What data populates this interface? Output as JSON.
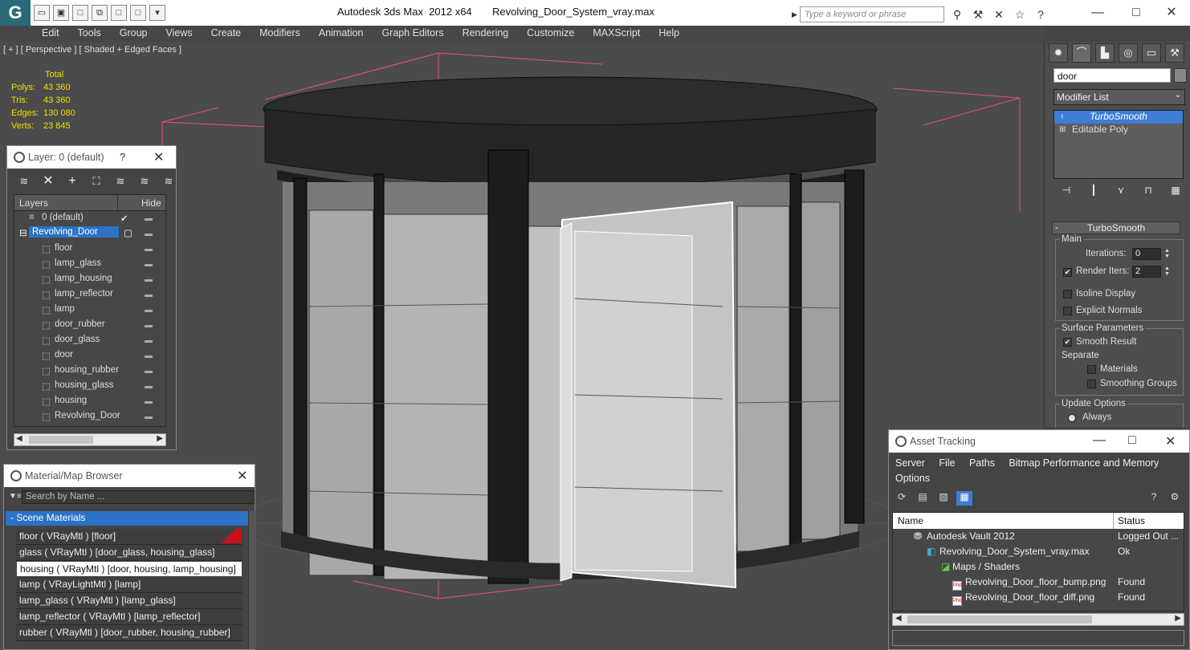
{
  "app": {
    "title": "Autodesk 3ds Max  2012 x64",
    "file": "Revolving_Door_System_vray.max",
    "logo": "max-logo",
    "search_placeholder": "Type a keyword or phrase"
  },
  "menu": [
    "Edit",
    "Tools",
    "Group",
    "Views",
    "Create",
    "Modifiers",
    "Animation",
    "Graph Editors",
    "Rendering",
    "Customize",
    "MAXScript",
    "Help"
  ],
  "viewport": {
    "label": "[ + ] [ Perspective ] [ Shaded + Edged Faces ]",
    "stats_header": "Total",
    "stats": [
      {
        "k": "Polys:",
        "v": "43 360"
      },
      {
        "k": "Tris:",
        "v": "43 360"
      },
      {
        "k": "Edges:",
        "v": "130 080"
      },
      {
        "k": "Verts:",
        "v": "23 845"
      }
    ]
  },
  "command_panel": {
    "object_name": "door",
    "modifier_list": "Modifier List",
    "stack": [
      {
        "label": "TurboSmooth",
        "selected": true
      },
      {
        "label": "Editable Poly",
        "selected": false
      }
    ],
    "rollout": {
      "title": "TurboSmooth",
      "main_label": "Main",
      "iterations_label": "Iterations:",
      "iterations_value": "0",
      "render_iters_label": "Render Iters:",
      "render_iters_value": "2",
      "isoline": "Isoline Display",
      "explicit": "Explicit Normals",
      "surface_label": "Surface Parameters",
      "smooth_result": "Smooth Result",
      "separate": "Separate",
      "materials": "Materials",
      "smoothing_groups": "Smoothing Groups",
      "update_label": "Update Options",
      "always": "Always"
    }
  },
  "layer_window": {
    "title": "Layer: 0 (default)",
    "help": "?",
    "col_layers": "Layers",
    "col_hide": "Hide",
    "rows": [
      {
        "name": "0 (default)",
        "indent": 1
      },
      {
        "name": "Revolving_Door",
        "indent": 1
      },
      {
        "name": "floor",
        "indent": 2
      },
      {
        "name": "lamp_glass",
        "indent": 2
      },
      {
        "name": "lamp_housing",
        "indent": 2
      },
      {
        "name": "lamp_reflector",
        "indent": 2
      },
      {
        "name": "lamp",
        "indent": 2
      },
      {
        "name": "door_rubber",
        "indent": 2
      },
      {
        "name": "door_glass",
        "indent": 2
      },
      {
        "name": "door",
        "indent": 2
      },
      {
        "name": "housing_rubber",
        "indent": 2
      },
      {
        "name": "housing_glass",
        "indent": 2
      },
      {
        "name": "housing",
        "indent": 2
      },
      {
        "name": "Revolving_Door",
        "indent": 2
      }
    ]
  },
  "material_browser": {
    "title": "Material/Map Browser",
    "search_placeholder": "Search by Name ...",
    "group": "- Scene Materials",
    "rows": [
      "floor  ( VRayMtl ) [floor]",
      "glass  ( VRayMtl ) [door_glass, housing_glass]",
      "housing  ( VRayMtl ) [door, housing, lamp_housing]",
      "lamp  ( VRayLightMtl ) [lamp]",
      "lamp_glass  ( VRayMtl ) [lamp_glass]",
      "lamp_reflector  ( VRayMtl ) [lamp_reflector]",
      "rubber  ( VRayMtl ) [door_rubber, housing_rubber]"
    ]
  },
  "asset_tracking": {
    "title": "Asset Tracking",
    "menus": [
      "Server",
      "File",
      "Paths",
      "Bitmap Performance and Memory",
      "Options"
    ],
    "col_name": "Name",
    "col_status": "Status",
    "rows": [
      {
        "name": "Autodesk Vault 2012",
        "status": "Logged Out ...",
        "indent": 22
      },
      {
        "name": "Revolving_Door_System_vray.max",
        "status": "Ok",
        "indent": 38
      },
      {
        "name": "Maps / Shaders",
        "status": "",
        "indent": 58
      },
      {
        "name": "Revolving_Door_floor_bump.png",
        "status": "Found",
        "indent": 74
      },
      {
        "name": "Revolving_Door_floor_diff.png",
        "status": "Found",
        "indent": 74
      }
    ]
  },
  "colors": {
    "selection": "#2c72c7",
    "stats": "#f0e000",
    "accent": "#3d7ed6"
  }
}
